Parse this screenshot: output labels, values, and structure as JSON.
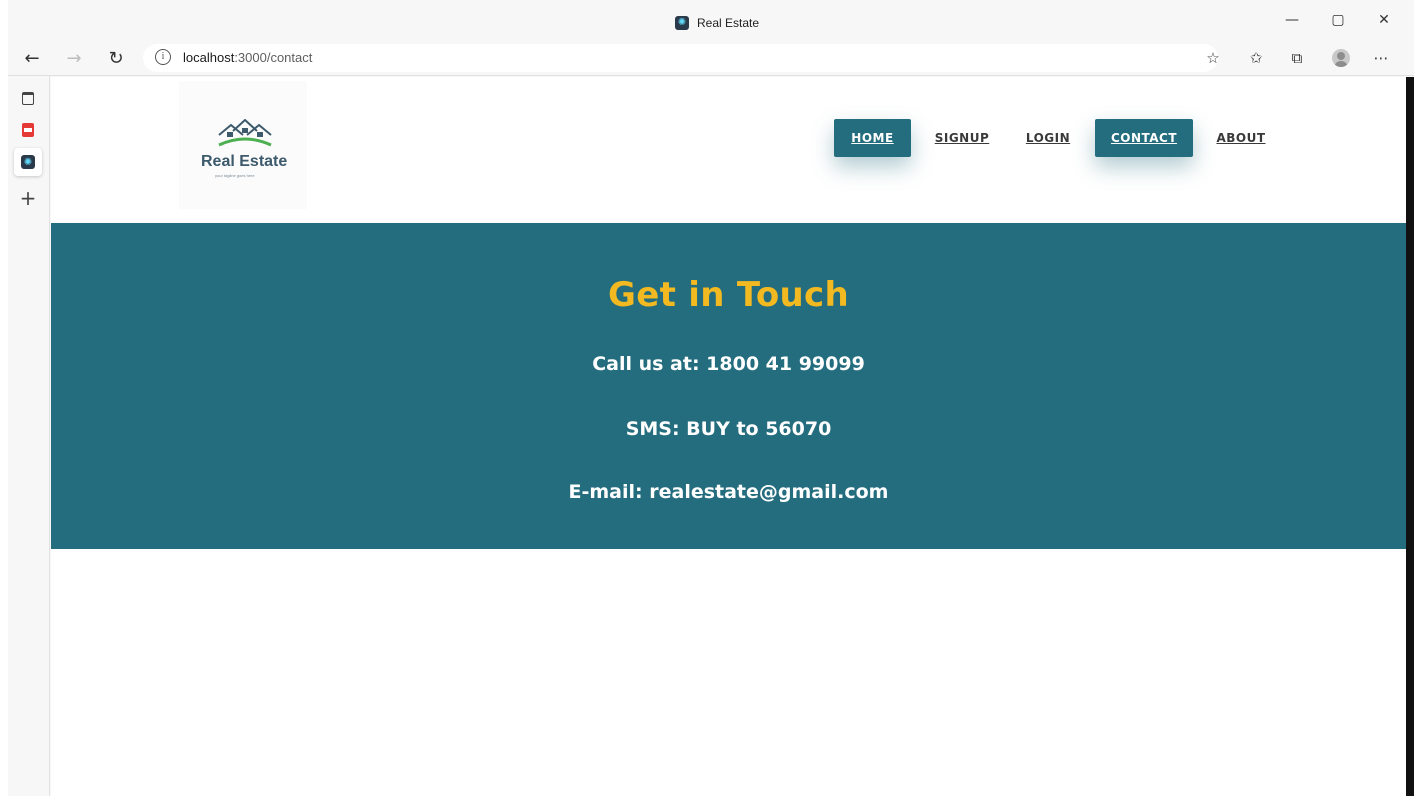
{
  "window": {
    "title": "Real Estate",
    "controls": [
      "minimize",
      "restore",
      "close"
    ]
  },
  "addressbar": {
    "url_host": "localhost",
    "url_path": ":3000/contact"
  },
  "sidebar": {
    "tabs": [
      {
        "icon": "tab-actions-icon"
      },
      {
        "icon": "pdf-icon"
      },
      {
        "icon": "react-icon",
        "active": true
      },
      {
        "icon": "plus-icon"
      }
    ]
  },
  "site": {
    "logo": {
      "brand": "Real Estate",
      "tagline": "your tagline goes here"
    },
    "nav": [
      {
        "label": "HOME",
        "style": "button"
      },
      {
        "label": "SIGNUP",
        "style": "link"
      },
      {
        "label": "LOGIN",
        "style": "link"
      },
      {
        "label": "CONTACT",
        "style": "button"
      },
      {
        "label": "ABOUT",
        "style": "link"
      }
    ],
    "contact": {
      "heading": "Get in Touch",
      "phone": "Call us at: 1800 41 99099",
      "sms": "SMS: BUY to 56070",
      "email": "E-mail: realestate@gmail.com"
    }
  },
  "colors": {
    "primary": "#246d7e",
    "heading": "#f3b920",
    "text_light": "#ffffff"
  }
}
